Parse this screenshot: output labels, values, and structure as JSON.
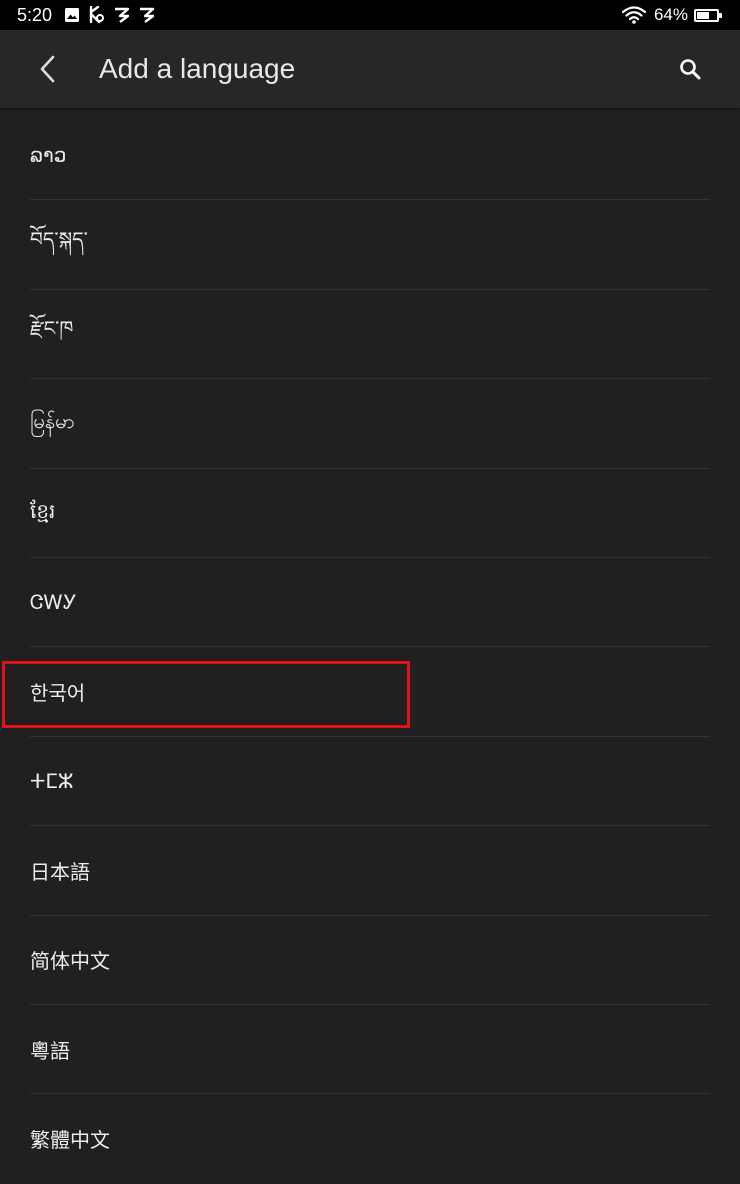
{
  "status_bar": {
    "time": "5:20",
    "battery_percent": "64%",
    "battery_level": 0.64,
    "notification_icons": [
      "image-icon",
      "kindle-app-icon",
      "amazon-app-icon",
      "amazon-app-icon"
    ]
  },
  "app_bar": {
    "title": "Add a language",
    "back_icon": "chevron-left-icon",
    "search_icon": "search-icon"
  },
  "languages": [
    "ລາວ",
    "བོད་སྐད་",
    "རྫོང་ཁ",
    "မြန်မာ",
    "ខ្មែរ",
    "ᏣᎳᎩ",
    "한국어",
    "ⵜⵎⵣ",
    "日本語",
    "简体中文",
    "粵語",
    "繁體中文"
  ],
  "highlighted_language": "한국어",
  "colors": {
    "background": "#202020",
    "app_bar": "#272727",
    "status_bar": "#000000",
    "divider": "#333333",
    "highlight": "#e0121b"
  }
}
